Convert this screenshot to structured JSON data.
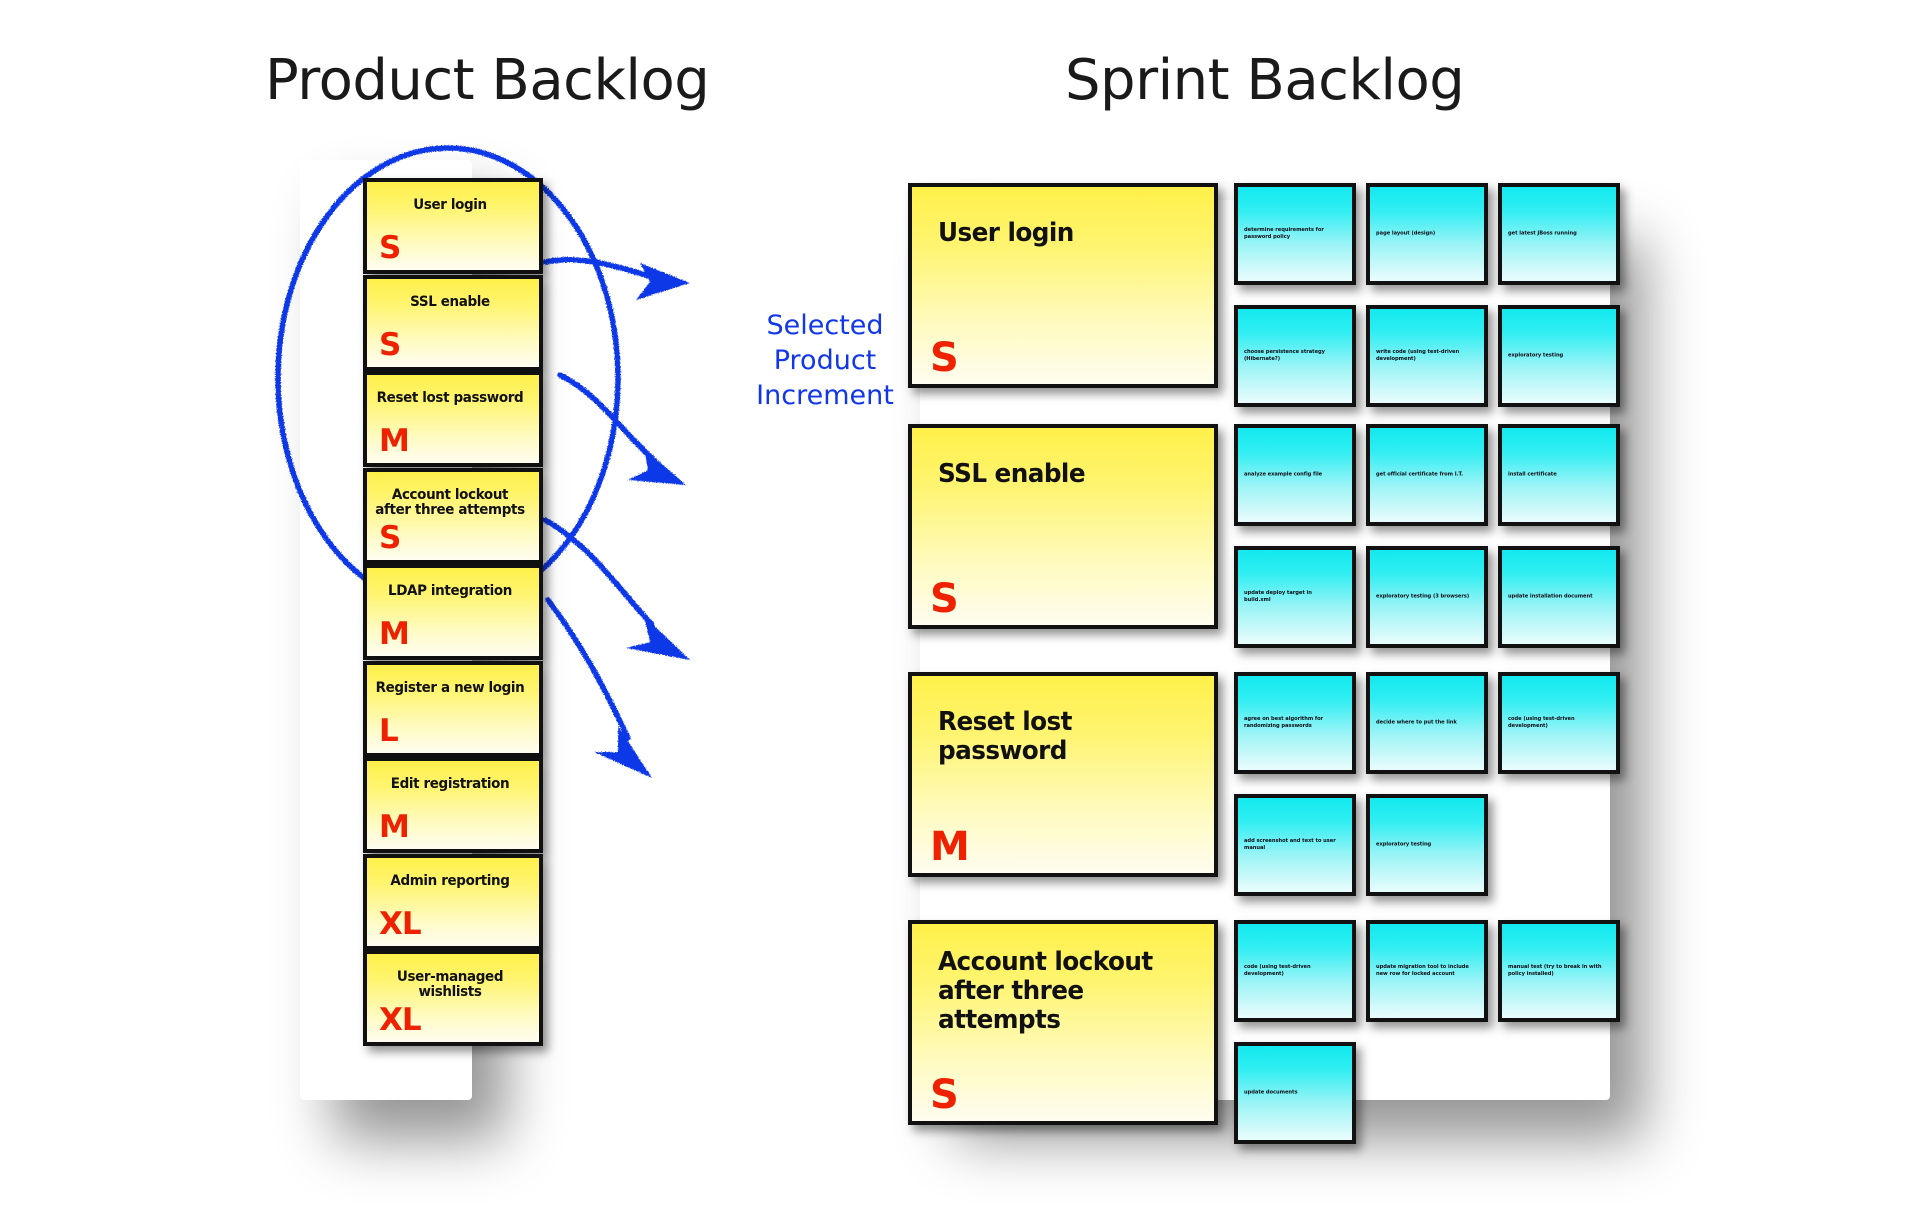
{
  "titles": {
    "product_backlog": "Product Backlog",
    "sprint_backlog": "Sprint Backlog"
  },
  "annotation": {
    "selected_increment": "Selected\nProduct\nIncrement",
    "selected_increment_line1": "Selected",
    "selected_increment_line2": "Product",
    "selected_increment_line3": "Increment",
    "ellipse_note": "hand-drawn blue ellipse around top four product backlog items",
    "arrow_count": 4,
    "ink_color": "#1137e8"
  },
  "colors": {
    "story_card": "#fff04a",
    "task_card": "#12e9ef",
    "size_letter": "#ee2200",
    "border": "#111111",
    "title_text": "#1a1a1a",
    "annotation": "#1137e8"
  },
  "product_backlog": {
    "items": [
      {
        "title": "User login",
        "size": "S",
        "selected": true
      },
      {
        "title": "SSL enable",
        "size": "S",
        "selected": true
      },
      {
        "title": "Reset lost password",
        "size": "M",
        "selected": true
      },
      {
        "title": "Account lockout\nafter three attempts",
        "size": "S",
        "selected": true
      },
      {
        "title": "LDAP integration",
        "size": "M",
        "selected": false
      },
      {
        "title": "Register a new login",
        "size": "L",
        "selected": false
      },
      {
        "title": "Edit registration",
        "size": "M",
        "selected": false
      },
      {
        "title": "Admin reporting",
        "size": "XL",
        "selected": false
      },
      {
        "title": "User-managed\nwishlists",
        "size": "XL",
        "selected": false
      }
    ]
  },
  "sprint_backlog": {
    "stories": [
      {
        "title": "User login",
        "size": "S",
        "tasks": [
          "determine requirements for password policy",
          "page layout (design)",
          "get latest JBoss running",
          "choose persistence strategy (Hibernate?)",
          "write code (using test-driven development)",
          "exploratory testing"
        ]
      },
      {
        "title": "SSL enable",
        "size": "S",
        "tasks": [
          "analyze example config file",
          "get official certificate from I.T.",
          "install certificate",
          "update deploy target in build.xml",
          "exploratory testing (3 browsers)",
          "update installation document"
        ]
      },
      {
        "title": "Reset lost password",
        "size": "M",
        "tasks": [
          "agree on best algorithm for randomizing passwords",
          "decide where to put the link",
          "code (using test-driven development)",
          "add screenshot and text to user manual",
          "exploratory testing"
        ]
      },
      {
        "title": "Account lockout\nafter three\nattempts",
        "size": "S",
        "tasks": [
          "code (using test-driven development)",
          "update migration tool to include new row for locked account",
          "manual test (try to break in with policy installed)",
          "update documents"
        ]
      }
    ]
  }
}
